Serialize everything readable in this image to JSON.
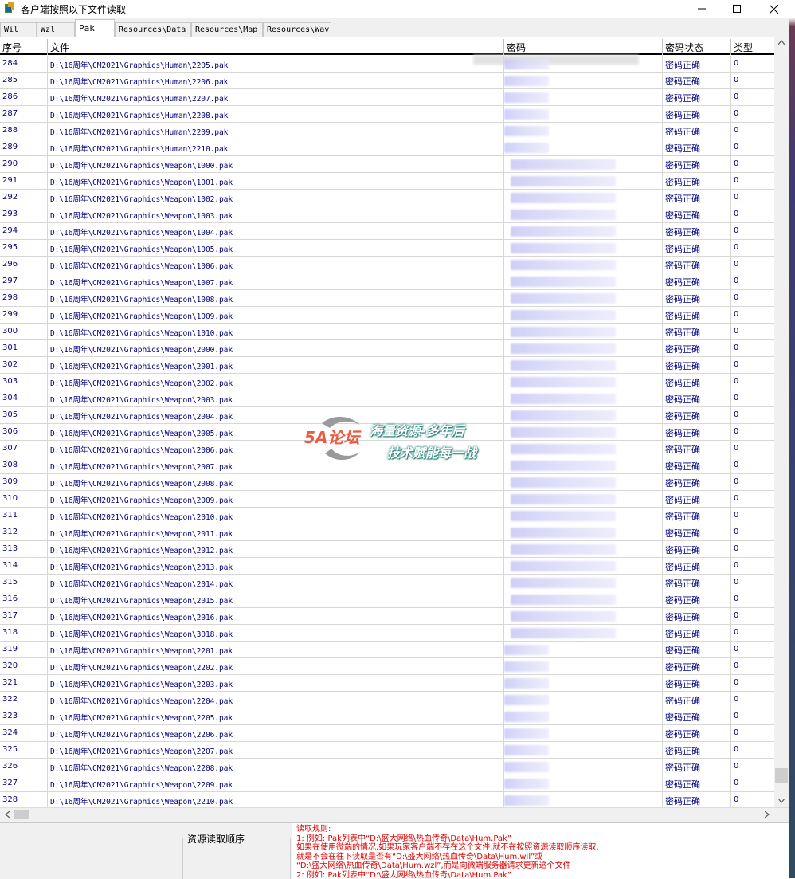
{
  "window": {
    "title": "客户端按照以下文件读取"
  },
  "tabs": [
    {
      "label": "Wil",
      "active": false
    },
    {
      "label": "Wzl",
      "active": false
    },
    {
      "label": "Pak",
      "active": true
    },
    {
      "label": "Resources\\Data",
      "active": false
    },
    {
      "label": "Resources\\Map",
      "active": false
    },
    {
      "label": "Resources\\Wav",
      "active": false
    }
  ],
  "grid": {
    "columns": {
      "index": "序号",
      "file": "文件",
      "password": "密码",
      "status": "密码状态",
      "type": "类型"
    },
    "status_text": "密码正确",
    "type_value": "0",
    "rows": [
      {
        "n": "284",
        "file": "D:\\16周年\\CM2021\\Graphics\\Human\\2205.pak"
      },
      {
        "n": "285",
        "file": "D:\\16周年\\CM2021\\Graphics\\Human\\2206.pak"
      },
      {
        "n": "286",
        "file": "D:\\16周年\\CM2021\\Graphics\\Human\\2207.pak"
      },
      {
        "n": "287",
        "file": "D:\\16周年\\CM2021\\Graphics\\Human\\2208.pak"
      },
      {
        "n": "288",
        "file": "D:\\16周年\\CM2021\\Graphics\\Human\\2209.pak"
      },
      {
        "n": "289",
        "file": "D:\\16周年\\CM2021\\Graphics\\Human\\2210.pak"
      },
      {
        "n": "290",
        "file": "D:\\16周年\\CM2021\\Graphics\\Weapon\\1000.pak"
      },
      {
        "n": "291",
        "file": "D:\\16周年\\CM2021\\Graphics\\Weapon\\1001.pak"
      },
      {
        "n": "292",
        "file": "D:\\16周年\\CM2021\\Graphics\\Weapon\\1002.pak"
      },
      {
        "n": "293",
        "file": "D:\\16周年\\CM2021\\Graphics\\Weapon\\1003.pak"
      },
      {
        "n": "294",
        "file": "D:\\16周年\\CM2021\\Graphics\\Weapon\\1004.pak"
      },
      {
        "n": "295",
        "file": "D:\\16周年\\CM2021\\Graphics\\Weapon\\1005.pak"
      },
      {
        "n": "296",
        "file": "D:\\16周年\\CM2021\\Graphics\\Weapon\\1006.pak"
      },
      {
        "n": "297",
        "file": "D:\\16周年\\CM2021\\Graphics\\Weapon\\1007.pak"
      },
      {
        "n": "298",
        "file": "D:\\16周年\\CM2021\\Graphics\\Weapon\\1008.pak"
      },
      {
        "n": "299",
        "file": "D:\\16周年\\CM2021\\Graphics\\Weapon\\1009.pak"
      },
      {
        "n": "300",
        "file": "D:\\16周年\\CM2021\\Graphics\\Weapon\\1010.pak"
      },
      {
        "n": "301",
        "file": "D:\\16周年\\CM2021\\Graphics\\Weapon\\2000.pak"
      },
      {
        "n": "302",
        "file": "D:\\16周年\\CM2021\\Graphics\\Weapon\\2001.pak"
      },
      {
        "n": "303",
        "file": "D:\\16周年\\CM2021\\Graphics\\Weapon\\2002.pak"
      },
      {
        "n": "304",
        "file": "D:\\16周年\\CM2021\\Graphics\\Weapon\\2003.pak"
      },
      {
        "n": "305",
        "file": "D:\\16周年\\CM2021\\Graphics\\Weapon\\2004.pak"
      },
      {
        "n": "306",
        "file": "D:\\16周年\\CM2021\\Graphics\\Weapon\\2005.pak"
      },
      {
        "n": "307",
        "file": "D:\\16周年\\CM2021\\Graphics\\Weapon\\2006.pak"
      },
      {
        "n": "308",
        "file": "D:\\16周年\\CM2021\\Graphics\\Weapon\\2007.pak"
      },
      {
        "n": "309",
        "file": "D:\\16周年\\CM2021\\Graphics\\Weapon\\2008.pak"
      },
      {
        "n": "310",
        "file": "D:\\16周年\\CM2021\\Graphics\\Weapon\\2009.pak"
      },
      {
        "n": "311",
        "file": "D:\\16周年\\CM2021\\Graphics\\Weapon\\2010.pak"
      },
      {
        "n": "312",
        "file": "D:\\16周年\\CM2021\\Graphics\\Weapon\\2011.pak"
      },
      {
        "n": "313",
        "file": "D:\\16周年\\CM2021\\Graphics\\Weapon\\2012.pak"
      },
      {
        "n": "314",
        "file": "D:\\16周年\\CM2021\\Graphics\\Weapon\\2013.pak"
      },
      {
        "n": "315",
        "file": "D:\\16周年\\CM2021\\Graphics\\Weapon\\2014.pak"
      },
      {
        "n": "316",
        "file": "D:\\16周年\\CM2021\\Graphics\\Weapon\\2015.pak"
      },
      {
        "n": "317",
        "file": "D:\\16周年\\CM2021\\Graphics\\Weapon\\2016.pak"
      },
      {
        "n": "318",
        "file": "D:\\16周年\\CM2021\\Graphics\\Weapon\\3018.pak"
      },
      {
        "n": "319",
        "file": "D:\\16周年\\CM2021\\Graphics\\Weapon\\2201.pak"
      },
      {
        "n": "320",
        "file": "D:\\16周年\\CM2021\\Graphics\\Weapon\\2202.pak"
      },
      {
        "n": "321",
        "file": "D:\\16周年\\CM2021\\Graphics\\Weapon\\2203.pak"
      },
      {
        "n": "322",
        "file": "D:\\16周年\\CM2021\\Graphics\\Weapon\\2204.pak"
      },
      {
        "n": "323",
        "file": "D:\\16周年\\CM2021\\Graphics\\Weapon\\2205.pak"
      },
      {
        "n": "324",
        "file": "D:\\16周年\\CM2021\\Graphics\\Weapon\\2206.pak"
      },
      {
        "n": "325",
        "file": "D:\\16周年\\CM2021\\Graphics\\Weapon\\2207.pak"
      },
      {
        "n": "326",
        "file": "D:\\16周年\\CM2021\\Graphics\\Weapon\\2208.pak"
      },
      {
        "n": "327",
        "file": "D:\\16周年\\CM2021\\Graphics\\Weapon\\2209.pak"
      },
      {
        "n": "328",
        "file": "D:\\16周年\\CM2021\\Graphics\\Weapon\\2210.pak"
      }
    ]
  },
  "bottom": {
    "order_label": "资源读取顺序",
    "rules_title": "读取规则:",
    "rules_lines": [
      "1: 例如: Pak列表中“D:\\盛大网络\\热血传奇\\Data\\Hum.Pak”",
      "    如果在使用微端的情况,如果玩家客户端不存在这个文件,就不在按照资源读取顺序读取,",
      "    就是不会在往下读取是否有“D:\\盛大网络\\热血传奇\\Data\\Hum.wil”或",
      "   “D:\\盛大网络\\热血传奇\\Data\\Hum.wzl”,而是向微端服务器请求更新这个文件",
      "2: 例如: Pak列表中“D:\\盛大网络\\热血传奇\\Data\\Hum.Pak”"
    ]
  },
  "watermark": {
    "logo": "5A论坛",
    "line1": "海量资源-多年后",
    "line2": "技术赋能每一战"
  },
  "icons": {
    "app": "app-icon",
    "minimize": "minimize-icon",
    "maximize": "maximize-icon",
    "close": "close-icon"
  },
  "colors": {
    "row_text": "#00007f",
    "rules_text": "#e00000",
    "password_blur": "#c4c4f5"
  }
}
